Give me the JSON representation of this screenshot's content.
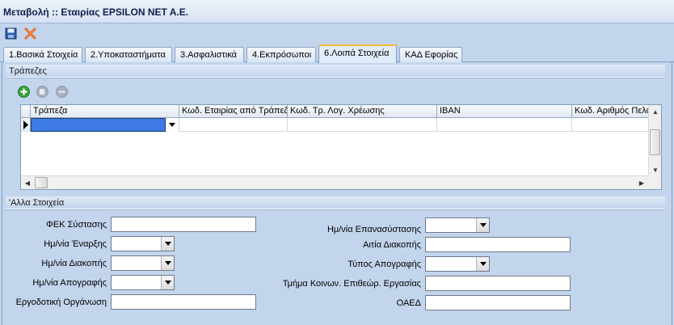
{
  "window": {
    "title": "Μεταβολή :: Εταιρίας EPSILON NET A.E."
  },
  "toolbar": {
    "save_icon": "save-icon",
    "cancel_icon": "close-icon"
  },
  "tabs": [
    {
      "label": "1.Βασικά Στοιχεία",
      "active": false
    },
    {
      "label": "2.Υποκαταστήματα",
      "active": false
    },
    {
      "label": "3.Ασφαλιστικά",
      "active": false
    },
    {
      "label": "4.Εκπρόσωποι",
      "active": false
    },
    {
      "label": "6.Λοιπά Στοιχεία",
      "active": true
    },
    {
      "label": "ΚΑΔ Εφορίας",
      "active": false
    }
  ],
  "banks": {
    "title": "Τράπεζες",
    "columns": [
      "Τράπεζα",
      "Κωδ. Εταιρίας από Τράπεζα",
      "Κωδ. Τρ. Λογ. Χρέωσης",
      "IBAN",
      "Κωδ. Αριθμός Πελά"
    ]
  },
  "other": {
    "title": "'Αλλα Στοιχεία",
    "left": [
      {
        "label": "ΦΕΚ Σύστασης",
        "value": "",
        "type": "text"
      },
      {
        "label": "Ημ/νία Έναρξης",
        "value": "",
        "type": "date"
      },
      {
        "label": "Ημ/νία Διακοπής",
        "value": "",
        "type": "date"
      },
      {
        "label": "Ημ/νία Απογραφής",
        "value": "",
        "type": "date"
      },
      {
        "label": "Εργοδοτική Οργάνωση",
        "value": "",
        "type": "text"
      }
    ],
    "right": [
      {
        "label": "Ημ/νία Επανασύστασης",
        "value": "",
        "type": "date"
      },
      {
        "label": "Αιτία Διακοπής",
        "value": "",
        "type": "text"
      },
      {
        "label": "Τύπος Απογραφής",
        "value": "",
        "type": "date"
      },
      {
        "label": "Τμήμα Κοινων. Επιθεώρ. Εργασίας",
        "value": "",
        "type": "text"
      },
      {
        "label": "ΟΑΕΔ",
        "value": "",
        "type": "text"
      }
    ]
  }
}
